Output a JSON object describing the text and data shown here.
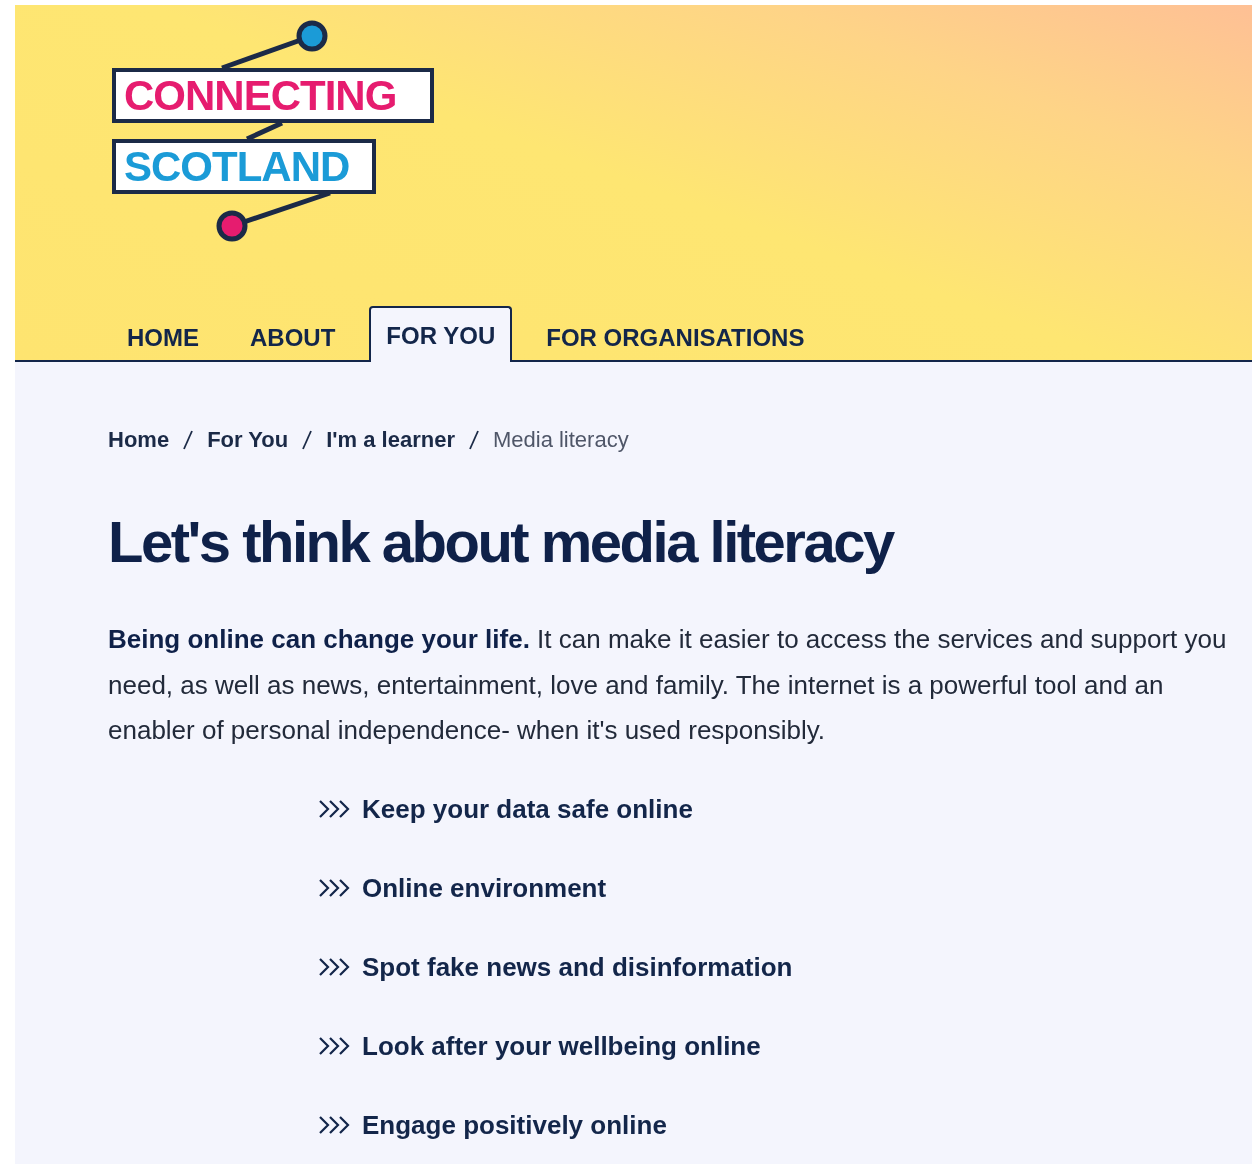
{
  "logo": {
    "line_1": "CONNECTING",
    "line_2": "SCOTLAND"
  },
  "nav": [
    {
      "label": "HOME",
      "selected": false
    },
    {
      "label": "ABOUT",
      "selected": false
    },
    {
      "label": "FOR YOU",
      "selected": true
    },
    {
      "label": "FOR ORGANISATIONS",
      "selected": false
    }
  ],
  "breadcrumb": [
    {
      "label": "Home",
      "current": false
    },
    {
      "label": "For You",
      "current": false
    },
    {
      "label": "I'm a learner",
      "current": false
    },
    {
      "label": "Media literacy",
      "current": true
    }
  ],
  "heading": "Let's think about media literacy",
  "intro": "**Being online can change your life.** It can make it easier to access the services and support you need, as well as news, entertainment, love and family. The internet is a powerful tool and an enabler of personal independence- when it's used responsibly.",
  "links": [
    "Keep your data safe online",
    "Online environment",
    "Spot fake news and disinformation",
    "Look after your wellbeing online",
    "Engage positively online"
  ]
}
